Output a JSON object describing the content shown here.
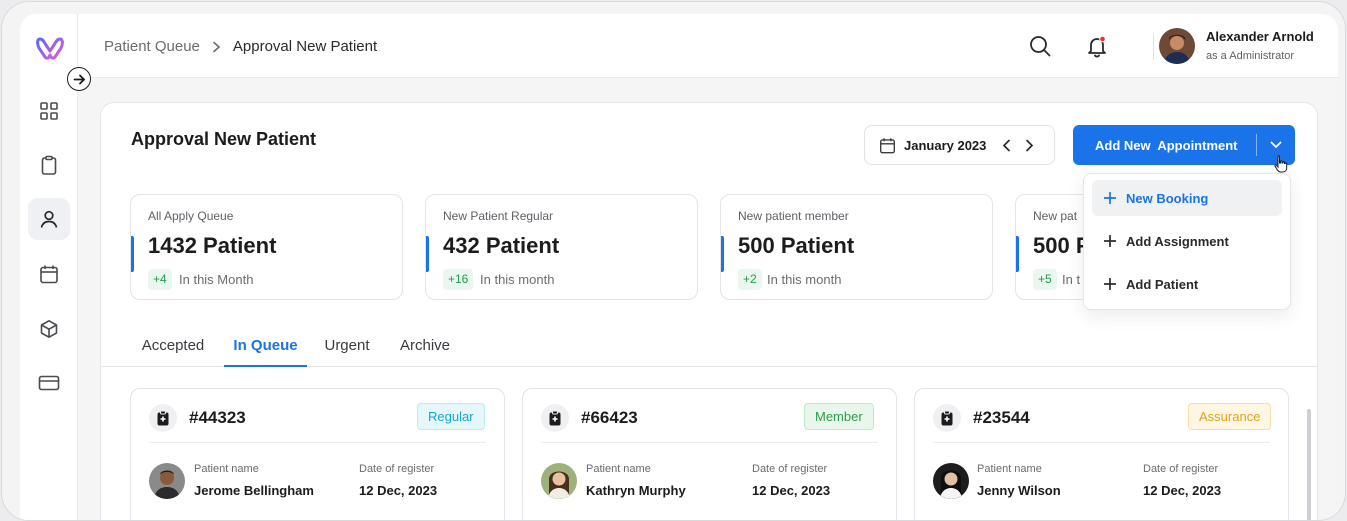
{
  "sidebar": {
    "logo": "w-logo",
    "items": [
      {
        "icon": "grid-icon"
      },
      {
        "icon": "clipboard-icon"
      },
      {
        "icon": "user-icon",
        "active": true
      },
      {
        "icon": "calendar-icon"
      },
      {
        "icon": "box-icon"
      },
      {
        "icon": "card-icon"
      }
    ]
  },
  "header": {
    "breadcrumb": [
      "Patient Queue",
      "Approval New Patient"
    ],
    "user": {
      "name": "Alexander Arnold",
      "role": "as a Administrator"
    }
  },
  "main": {
    "title": "Approval New Patient",
    "date": "January 2023",
    "add_button": "Add New  Appointment",
    "dropdown": [
      "New Booking",
      "Add Assignment",
      "Add Patient"
    ],
    "stats": [
      {
        "label": "All Apply Queue",
        "value": "1432 Patient",
        "delta": "+4",
        "period": "In this Month"
      },
      {
        "label": "New Patient Regular",
        "value": "432 Patient",
        "delta": "+16",
        "period": "In this month"
      },
      {
        "label": "New patient member",
        "value": "500 Patient",
        "delta": "+2",
        "period": "In this month"
      },
      {
        "label": "New pat",
        "value": "500 P",
        "delta": "+5",
        "period": "In t"
      }
    ],
    "tabs": [
      "Accepted",
      "In Queue",
      "Urgent",
      "Archive"
    ],
    "active_tab": "In Queue",
    "patients": [
      {
        "id": "#44323",
        "badge": "Regular",
        "name_label": "Patient name",
        "name": "Jerome Bellingham",
        "date_label": "Date of register",
        "date": "12 Dec, 2023"
      },
      {
        "id": "#66423",
        "badge": "Member",
        "name_label": "Patient name",
        "name": "Kathryn Murphy",
        "date_label": "Date of register",
        "date": "12 Dec, 2023"
      },
      {
        "id": "#23544",
        "badge": "Assurance",
        "name_label": "Patient name",
        "name": "Jenny Wilson",
        "date_label": "Date of register",
        "date": "12 Dec, 2023"
      }
    ]
  },
  "colors": {
    "accent": "#1a73e8",
    "notification": "#e5312b",
    "positive": "#1f9d4b"
  }
}
